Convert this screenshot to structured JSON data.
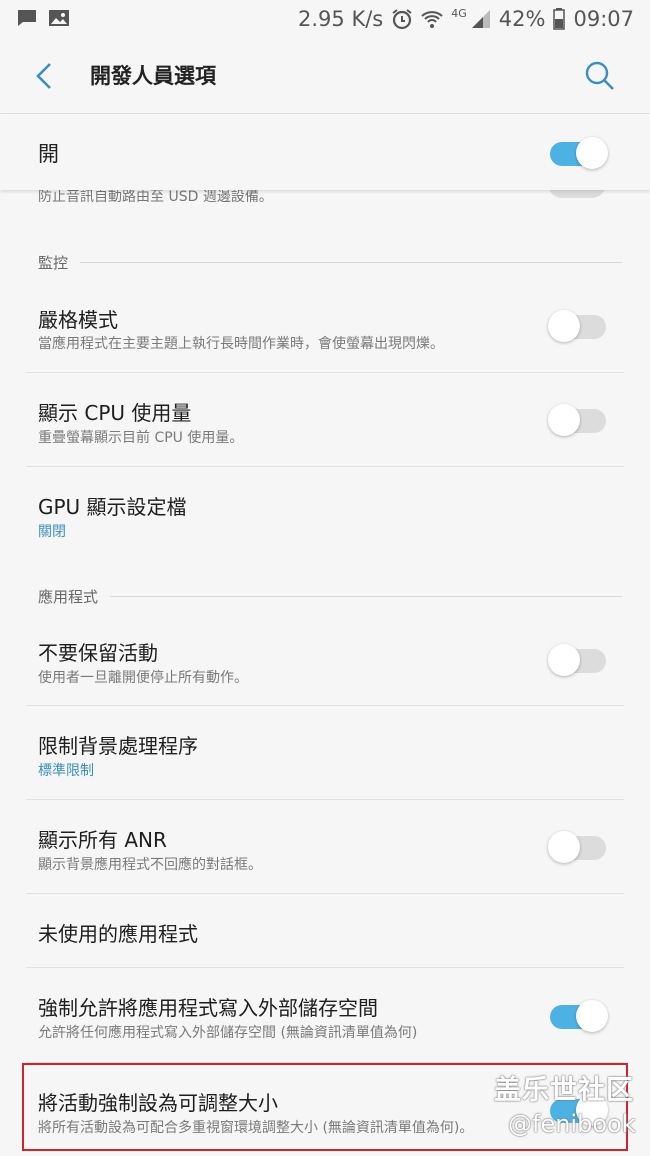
{
  "status_bar": {
    "speed": "2.95 K/s",
    "network": "4G",
    "battery": "42%",
    "time": "09:07"
  },
  "header": {
    "title": "開發人員選項"
  },
  "master_switch": {
    "label": "開",
    "on": true
  },
  "partial_item": {
    "subtitle": "防止音訊自動路由至 USD 週邊設備。"
  },
  "sections": {
    "monitor": "監控",
    "apps": "應用程式"
  },
  "items": [
    {
      "title": "嚴格模式",
      "subtitle": "當應用程式在主要主題上執行長時間作業時，會使螢幕出現閃爍。",
      "switch": false
    },
    {
      "title": "顯示 CPU 使用量",
      "subtitle": "重疊螢幕顯示目前 CPU 使用量。",
      "switch": false
    },
    {
      "title": "GPU 顯示設定檔",
      "subtitle": "關閉"
    },
    {
      "title": "不要保留活動",
      "subtitle": "使用者一旦離開便停止所有動作。",
      "switch": false
    },
    {
      "title": "限制背景處理程序",
      "subtitle": "標準限制"
    },
    {
      "title": "顯示所有 ANR",
      "subtitle": "顯示背景應用程式不回應的對話框。",
      "switch": false
    },
    {
      "title": "未使用的應用程式"
    },
    {
      "title": "強制允許將應用程式寫入外部儲存空間",
      "subtitle": "允許將任何應用程式寫入外部儲存空間 (無論資訊清單值為何)",
      "switch": true
    },
    {
      "title": "將活動強制設為可調整大小",
      "subtitle": "將所有活動設為可配合多重視窗環境調整大小 (無論資訊清單值為何)。",
      "switch": true
    }
  ],
  "watermark": {
    "main": "盖乐世社区",
    "sub": "@fenibook"
  },
  "colors": {
    "accent": "#4db2e3",
    "link": "#3a8fbf",
    "highlight": "#d0242a",
    "background": "#f6f6f6"
  }
}
